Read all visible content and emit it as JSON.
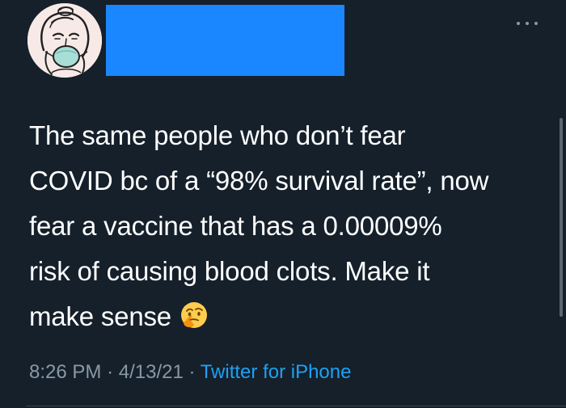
{
  "tweet": {
    "text_lines": [
      "The same people who don’t fear",
      "COVID bc of a “98% survival rate”, now",
      "fear a vaccine that has a 0.00009%",
      "risk of causing blood clots. Make it",
      "make sense"
    ],
    "emoji_name": "thinking-face",
    "time": "8:26 PM",
    "separator": "·",
    "date": "4/13/21",
    "source": "Twitter for iPhone"
  },
  "colors": {
    "background": "#15202b",
    "redaction": "#1a86ff",
    "link": "#1da1f2",
    "muted": "#8899a6"
  },
  "icons": {
    "more": "more-horizontal-icon",
    "avatar": "avatar-illustration"
  }
}
